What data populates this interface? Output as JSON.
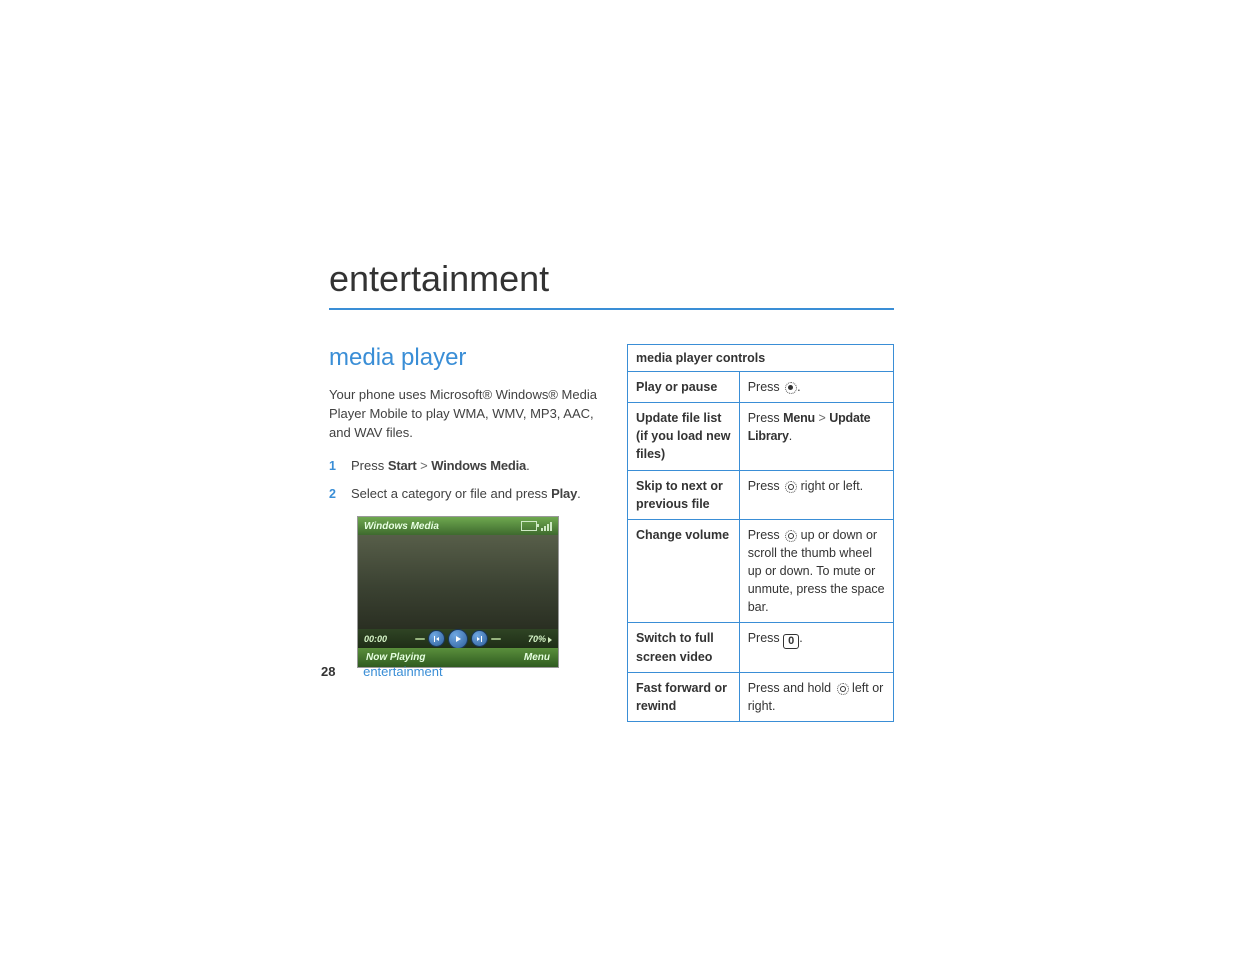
{
  "chapter_title": "entertainment",
  "section_title": "media player",
  "intro_text": "Your phone uses Microsoft® Windows® Media Player Mobile to play WMA, WMV, MP3, AAC, and WAV files.",
  "steps": {
    "s1_prefix": "Press ",
    "s1_menu_a": "Start",
    "s1_menu_sep": " > ",
    "s1_menu_b": "Windows Media",
    "s1_suffix": ".",
    "s2_prefix": "Select a category or file and press ",
    "s2_menu": "Play",
    "s2_suffix": "."
  },
  "phone": {
    "title": "Windows Media",
    "time": "00:00",
    "volume": "70%",
    "softkey_left": "Now Playing",
    "softkey_right": "Menu"
  },
  "table_header": "media player controls",
  "rows": {
    "r1_k": "Play or pause",
    "r1_v_prefix": "Press ",
    "r1_v_suffix": ".",
    "r2_k": "Update file list (if you load new files)",
    "r2_v_prefix": "Press ",
    "r2_v_menu_a": "Menu",
    "r2_v_sep": " > ",
    "r2_v_menu_b": "Update Library",
    "r2_v_suffix": ".",
    "r3_k": "Skip to next or previous file",
    "r3_v_prefix": "Press ",
    "r3_v_suffix": " right or left.",
    "r4_k": "Change volume",
    "r4_v_prefix": "Press ",
    "r4_v_suffix": " up or down or scroll the thumb wheel up or down. To mute or unmute, press the space bar.",
    "r5_k": "Switch to full screen video",
    "r5_v_prefix": "Press ",
    "r5_key": "0",
    "r5_v_suffix": ".",
    "r6_k": "Fast forward or rewind",
    "r6_v_prefix": "Press and hold ",
    "r6_v_suffix": " left or right."
  },
  "footer": {
    "page_number": "28",
    "running_title": "entertainment"
  }
}
